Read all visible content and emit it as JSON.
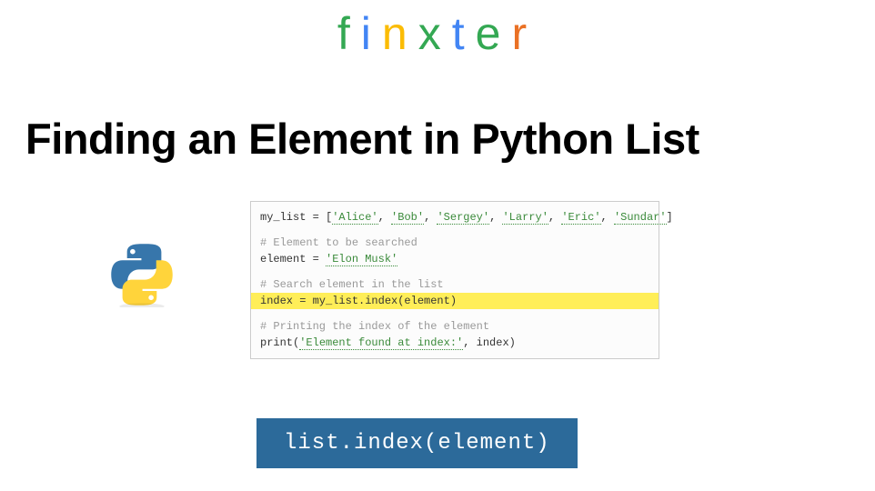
{
  "logo": {
    "letters": [
      "f",
      "i",
      "n",
      "x",
      "t",
      "e",
      "r"
    ],
    "colors": [
      "#34a853",
      "#4285f4",
      "#fbbc05",
      "#34a853",
      "#4285f4",
      "#34a853",
      "#ea7125"
    ]
  },
  "title": "Finding an Element in Python List",
  "code": {
    "line1_prefix": "my_list = [",
    "list_items": [
      "'Alice'",
      "'Bob'",
      "'Sergey'",
      "'Larry'",
      "'Eric'",
      "'Sundar'"
    ],
    "line1_suffix": "]",
    "comment1": "# Element to be searched",
    "line2_prefix": "element = ",
    "line2_str": "'Elon Musk'",
    "comment2": "# Search element in the list",
    "line3": "index = my_list.index(element)",
    "comment3": "# Printing the index of the element",
    "line4_prefix": "print(",
    "line4_str": "'Element found at index:'",
    "line4_suffix": ", index)"
  },
  "method_banner": "list.index(element)"
}
